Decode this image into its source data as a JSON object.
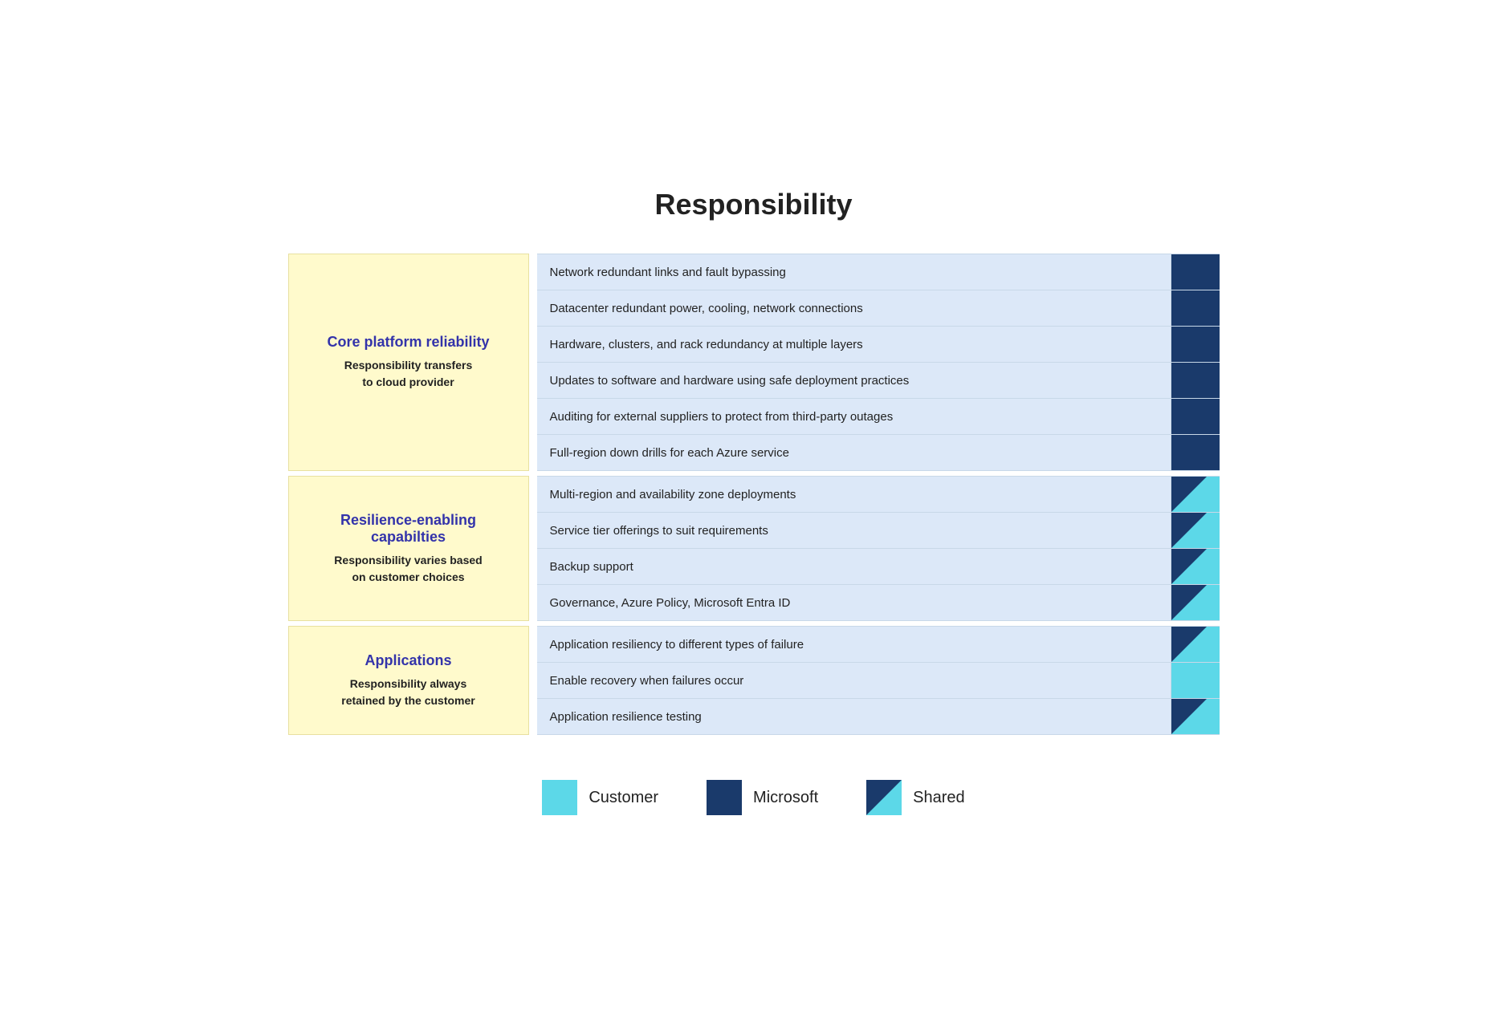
{
  "page": {
    "title": "Responsibility"
  },
  "sections": [
    {
      "id": "core-platform",
      "title": "Core platform reliability",
      "subtitle": "Responsibility transfers\nto cloud provider",
      "items": [
        {
          "text": "Network redundant links and fault bypassing",
          "indicator": "microsoft"
        },
        {
          "text": "Datacenter redundant power, cooling, network connections",
          "indicator": "microsoft"
        },
        {
          "text": "Hardware, clusters, and rack redundancy at multiple layers",
          "indicator": "microsoft"
        },
        {
          "text": "Updates to software and hardware using safe deployment practices",
          "indicator": "microsoft"
        },
        {
          "text": "Auditing for external suppliers to protect from third-party outages",
          "indicator": "microsoft"
        },
        {
          "text": "Full-region down drills for each Azure service",
          "indicator": "microsoft"
        }
      ]
    },
    {
      "id": "resilience-enabling",
      "title": "Resilience-enabling capabilties",
      "subtitle": "Responsibility varies based\non customer choices",
      "items": [
        {
          "text": "Multi-region and availability zone deployments",
          "indicator": "shared"
        },
        {
          "text": "Service tier offerings to suit requirements",
          "indicator": "shared"
        },
        {
          "text": "Backup support",
          "indicator": "shared"
        },
        {
          "text": "Governance, Azure Policy, Microsoft Entra ID",
          "indicator": "shared"
        }
      ]
    },
    {
      "id": "applications",
      "title": "Applications",
      "subtitle": "Responsibility always\nretained by the customer",
      "items": [
        {
          "text": "Application resiliency to different types of failure",
          "indicator": "shared"
        },
        {
          "text": "Enable recovery when failures occur",
          "indicator": "customer"
        },
        {
          "text": "Application resilience testing",
          "indicator": "shared"
        }
      ]
    }
  ],
  "legend": {
    "items": [
      {
        "id": "customer",
        "label": "Customer",
        "type": "customer"
      },
      {
        "id": "microsoft",
        "label": "Microsoft",
        "type": "microsoft"
      },
      {
        "id": "shared",
        "label": "Shared",
        "type": "shared"
      }
    ]
  }
}
